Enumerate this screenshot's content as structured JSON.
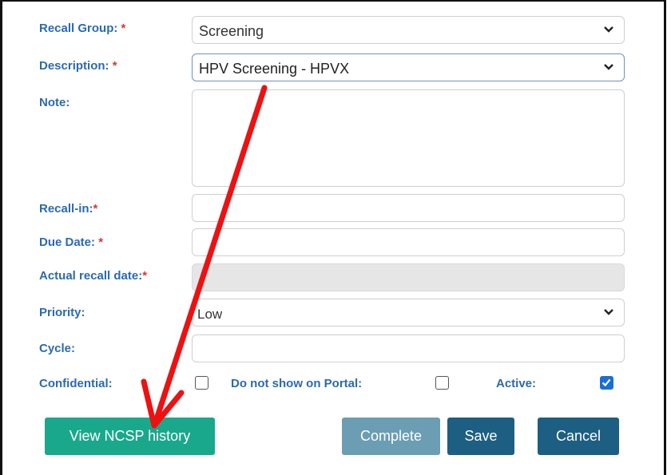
{
  "form": {
    "recall_group": {
      "label": "Recall Group:",
      "required_mark": "*",
      "value": "Screening"
    },
    "description": {
      "label": "Description:",
      "required_mark": "*",
      "value": "HPV Screening - HPVX"
    },
    "note": {
      "label": "Note:",
      "value": ""
    },
    "recall_in": {
      "label": "Recall-in:",
      "required_mark": "*",
      "value": ""
    },
    "due_date": {
      "label": "Due Date:",
      "required_mark": "*",
      "value": ""
    },
    "actual_recall_date": {
      "label": "Actual recall date:",
      "required_mark": "*",
      "value": ""
    },
    "priority": {
      "label": "Priority:",
      "value": "Low"
    },
    "cycle": {
      "label": "Cycle:",
      "value": ""
    },
    "confidential": {
      "label": "Confidential:",
      "checked": false
    },
    "do_not_show_portal": {
      "label": "Do not show on Portal:",
      "checked": false
    },
    "active": {
      "label": "Active:",
      "checked": true
    }
  },
  "buttons": {
    "view_history": "View NCSP history",
    "complete": "Complete",
    "save": "Save",
    "cancel": "Cancel"
  },
  "colors": {
    "label": "#2a6ab1",
    "required": "#e0332b",
    "view_history_bg": "#1aa88c",
    "complete_bg": "#6b9db3",
    "save_bg": "#1d5f82",
    "cancel_bg": "#1d5f82",
    "arrow": "#ee1111",
    "checkbox_checked": "#1a6fd4"
  }
}
